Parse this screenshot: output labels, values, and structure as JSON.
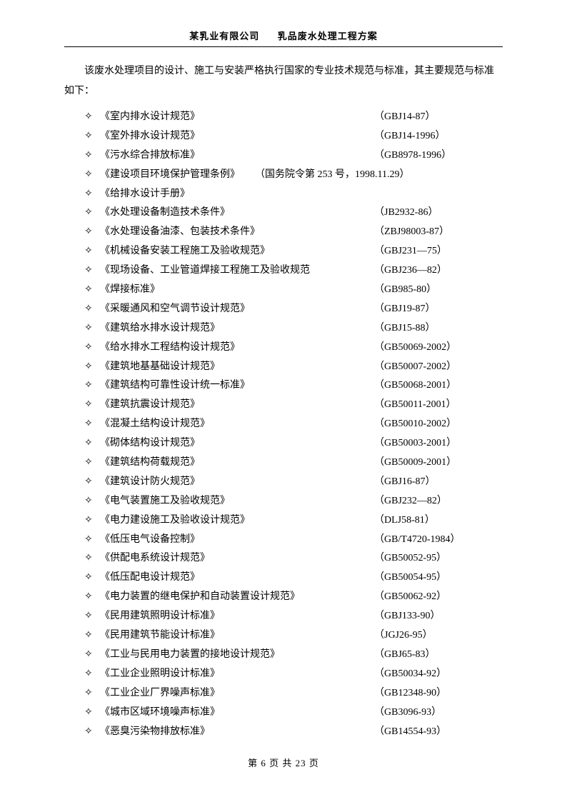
{
  "header": {
    "left": "某乳业有限公司",
    "right": "乳品废水处理工程方案"
  },
  "intro": "该废水处理项目的设计、施工与安装严格执行国家的专业技术规范与标准，其主要规范与标准如下：",
  "items": [
    {
      "title": "《室内排水设计规范》",
      "code": "（GBJ14-87）"
    },
    {
      "title": "《室外排水设计规范》",
      "code": "（GBJ14-1996）"
    },
    {
      "title": "《污水综合排放标准》",
      "code": "（GB8978-1996）"
    },
    {
      "title": "《建设项目环境保护管理条例》",
      "code": "（国务院令第 253 号，1998.11.29）",
      "inline": true
    },
    {
      "title": "《给排水设计手册》",
      "code": ""
    },
    {
      "title": "《水处理设备制造技术条件》",
      "code": "（JB2932-86）"
    },
    {
      "title": "《水处理设备油漆、包装技术条件》",
      "code": "（ZBJ98003-87）"
    },
    {
      "title": "《机械设备安装工程施工及验收规范》",
      "code": "（GBJ231—75）"
    },
    {
      "title": "《现场设备、工业管道焊接工程施工及验收规范",
      "code": "（GBJ236—82）"
    },
    {
      "title": "《焊接标准》",
      "code": "（GB985-80）"
    },
    {
      "title": "《采暖通风和空气调节设计规范》",
      "code": "（GBJ19-87）"
    },
    {
      "title": "《建筑给水排水设计规范》",
      "code": "（GBJ15-88）"
    },
    {
      "title": "《给水排水工程结构设计规范》",
      "code": "（GB50069-2002）"
    },
    {
      "title": "《建筑地基基础设计规范》",
      "code": "（GB50007-2002）"
    },
    {
      "title": "《建筑结构可靠性设计统一标准》",
      "code": "（GB50068-2001）"
    },
    {
      "title": "《建筑抗震设计规范》",
      "code": "（GB50011-2001）"
    },
    {
      "title": "《混凝土结构设计规范》",
      "code": "（GB50010-2002）"
    },
    {
      "title": "《砌体结构设计规范》",
      "code": "（GB50003-2001）"
    },
    {
      "title": "《建筑结构荷载规范》",
      "code": "（GB50009-2001）"
    },
    {
      "title": "《建筑设计防火规范》",
      "code": "（GBJ16-87）"
    },
    {
      "title": "《电气装置施工及验收规范》",
      "code": "（GBJ232—82）"
    },
    {
      "title": "《电力建设施工及验收设计规范》",
      "code": "（DLJ58-81）"
    },
    {
      "title": "《低压电气设备控制》",
      "code": "（GB/T4720-1984）"
    },
    {
      "title": "《供配电系统设计规范》",
      "code": "（GB50052-95）"
    },
    {
      "title": "《低压配电设计规范》",
      "code": "（GB50054-95）"
    },
    {
      "title": "《电力装置的继电保护和自动装置设计规范》",
      "code": "（GB50062-92）"
    },
    {
      "title": "《民用建筑照明设计标准》",
      "code": "（GBJ133-90）"
    },
    {
      "title": "《民用建筑节能设计标准》",
      "code": "（JGJ26-95）"
    },
    {
      "title": "《工业与民用电力装置的接地设计规范》",
      "code": "（GBJ65-83）"
    },
    {
      "title": "《工业企业照明设计标准》",
      "code": "（GB50034-92）"
    },
    {
      "title": "《工业企业厂界噪声标准》",
      "code": "（GB12348-90）"
    },
    {
      "title": "《城市区域环境噪声标准》",
      "code": "（GB3096-93）"
    },
    {
      "title": "《恶臭污染物排放标准》",
      "code": "（GB14554-93）"
    }
  ],
  "footer": {
    "prefix": "第",
    "page": "6",
    "mid": "页 共",
    "total": "23",
    "suffix": "页"
  }
}
